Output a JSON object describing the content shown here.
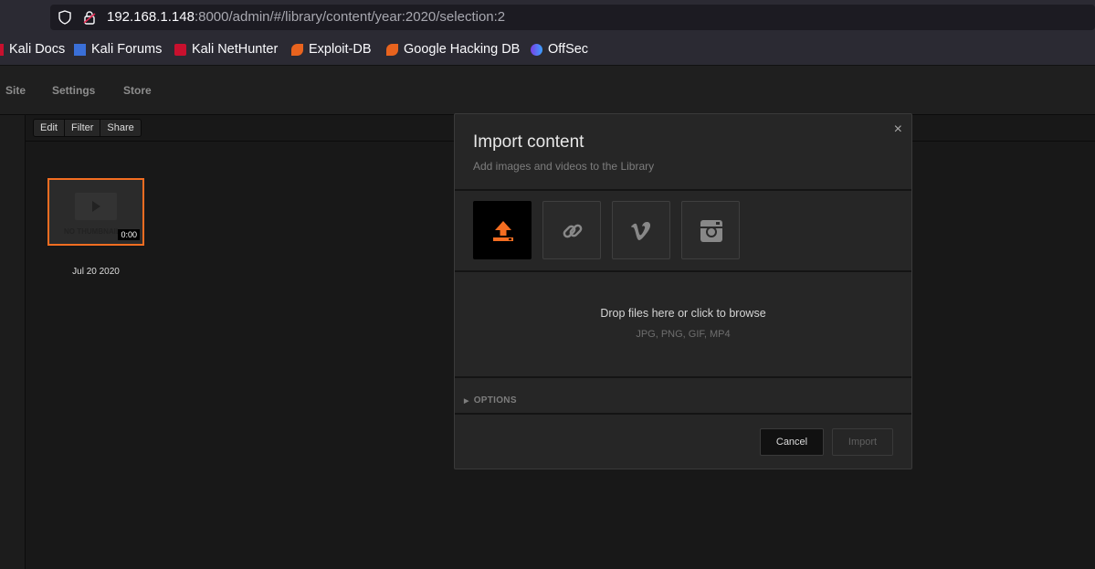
{
  "browser": {
    "url_host": "192.168.1.148",
    "url_rest": ":8000/admin/#/library/content/year:2020/selection:2",
    "bookmarks": [
      {
        "label": "Kali Docs",
        "icon": "kali-icon"
      },
      {
        "label": "Kali Forums",
        "icon": "kali-forums-icon"
      },
      {
        "label": "Kali NetHunter",
        "icon": "nethunter-icon"
      },
      {
        "label": "Exploit-DB",
        "icon": "exploit-db-icon"
      },
      {
        "label": "Google Hacking DB",
        "icon": "ghdb-icon"
      },
      {
        "label": "OffSec",
        "icon": "offsec-icon"
      }
    ]
  },
  "nav": {
    "site": "Site",
    "settings": "Settings",
    "store": "Store"
  },
  "toolbar": {
    "edit": "Edit",
    "filter": "Filter",
    "share": "Share"
  },
  "library": {
    "thumb_placeholder": "NO THUMBNAIL",
    "duration": "0:00",
    "date": "Jul 20 2020"
  },
  "modal": {
    "title": "Import content",
    "subtitle": "Add images and videos to the Library",
    "close": "×",
    "sources": [
      "upload-icon",
      "link-icon",
      "vimeo-icon",
      "instagram-icon"
    ],
    "drop_text": "Drop files here or click to browse",
    "formats": "JPG, PNG, GIF, MP4",
    "options": "OPTIONS",
    "cancel": "Cancel",
    "import": "Import"
  },
  "colors": {
    "accent": "#f36d21",
    "background": "#181818",
    "modal": "#262626"
  }
}
